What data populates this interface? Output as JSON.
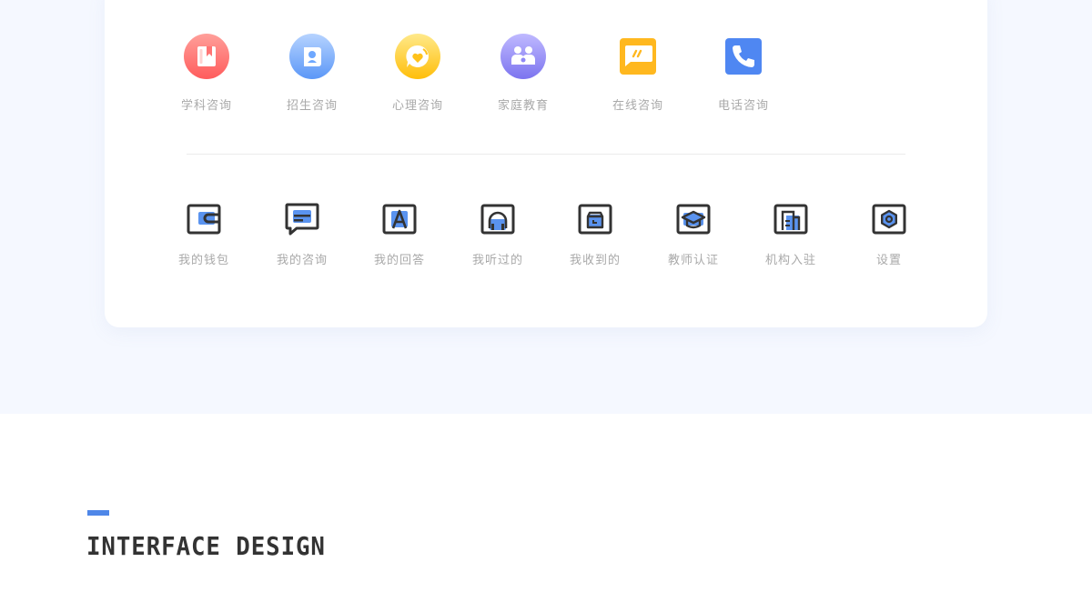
{
  "consult_services": [
    {
      "label": "学科咨询",
      "icon": "bookmark-book-icon",
      "color": "#ff6f6f"
    },
    {
      "label": "招生咨询",
      "icon": "student-badge-icon",
      "color": "#6ea8ff"
    },
    {
      "label": "心理咨询",
      "icon": "heart-chat-icon",
      "color": "#ffc21a"
    },
    {
      "label": "家庭教育",
      "icon": "family-icon",
      "color": "#8f88f6"
    },
    {
      "label": "在线咨询",
      "icon": "online-chat-icon",
      "color": "#ffb81f"
    },
    {
      "label": "电话咨询",
      "icon": "phone-icon",
      "color": "#4f87f2"
    }
  ],
  "user_menu": [
    {
      "label": "我的钱包",
      "icon": "wallet-icon"
    },
    {
      "label": "我的咨询",
      "icon": "message-icon"
    },
    {
      "label": "我的回答",
      "icon": "answer-icon"
    },
    {
      "label": "我听过的",
      "icon": "headphones-icon"
    },
    {
      "label": "我收到的",
      "icon": "inbox-icon"
    },
    {
      "label": "教师认证",
      "icon": "graduation-cap-icon"
    },
    {
      "label": "机构入驻",
      "icon": "building-icon"
    },
    {
      "label": "设置",
      "icon": "settings-icon"
    }
  ],
  "section": {
    "title": "INTERFACE DESIGN",
    "accent_color": "#4f87e8"
  }
}
